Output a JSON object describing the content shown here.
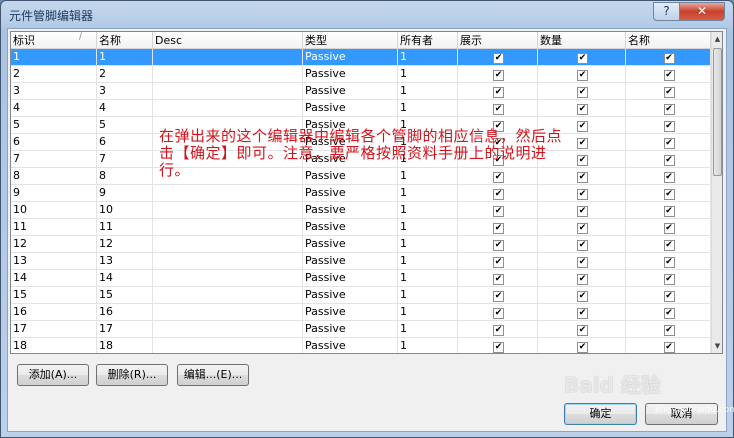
{
  "window": {
    "title": "元件管脚编辑器",
    "help_label": "?",
    "close_label": "✕"
  },
  "columns": [
    "标识",
    "名称",
    "Desc",
    "类型",
    "所有者",
    "展示",
    "数量",
    "名称"
  ],
  "rows": [
    {
      "id": "1",
      "name": "1",
      "desc": "",
      "type": "Passive",
      "owner": "1",
      "show": true,
      "qty": true,
      "named": true
    },
    {
      "id": "2",
      "name": "2",
      "desc": "",
      "type": "Passive",
      "owner": "1",
      "show": true,
      "qty": true,
      "named": true
    },
    {
      "id": "3",
      "name": "3",
      "desc": "",
      "type": "Passive",
      "owner": "1",
      "show": true,
      "qty": true,
      "named": true
    },
    {
      "id": "4",
      "name": "4",
      "desc": "",
      "type": "Passive",
      "owner": "1",
      "show": true,
      "qty": true,
      "named": true
    },
    {
      "id": "5",
      "name": "5",
      "desc": "",
      "type": "Passive",
      "owner": "1",
      "show": true,
      "qty": true,
      "named": true
    },
    {
      "id": "6",
      "name": "6",
      "desc": "",
      "type": "Passive",
      "owner": "1",
      "show": true,
      "qty": true,
      "named": true
    },
    {
      "id": "7",
      "name": "7",
      "desc": "",
      "type": "Passive",
      "owner": "1",
      "show": true,
      "qty": true,
      "named": true
    },
    {
      "id": "8",
      "name": "8",
      "desc": "",
      "type": "Passive",
      "owner": "1",
      "show": true,
      "qty": true,
      "named": true
    },
    {
      "id": "9",
      "name": "9",
      "desc": "",
      "type": "Passive",
      "owner": "1",
      "show": true,
      "qty": true,
      "named": true
    },
    {
      "id": "10",
      "name": "10",
      "desc": "",
      "type": "Passive",
      "owner": "1",
      "show": true,
      "qty": true,
      "named": true
    },
    {
      "id": "11",
      "name": "11",
      "desc": "",
      "type": "Passive",
      "owner": "1",
      "show": true,
      "qty": true,
      "named": true
    },
    {
      "id": "12",
      "name": "12",
      "desc": "",
      "type": "Passive",
      "owner": "1",
      "show": true,
      "qty": true,
      "named": true
    },
    {
      "id": "13",
      "name": "13",
      "desc": "",
      "type": "Passive",
      "owner": "1",
      "show": true,
      "qty": true,
      "named": true
    },
    {
      "id": "14",
      "name": "14",
      "desc": "",
      "type": "Passive",
      "owner": "1",
      "show": true,
      "qty": true,
      "named": true
    },
    {
      "id": "15",
      "name": "15",
      "desc": "",
      "type": "Passive",
      "owner": "1",
      "show": true,
      "qty": true,
      "named": true
    },
    {
      "id": "16",
      "name": "16",
      "desc": "",
      "type": "Passive",
      "owner": "1",
      "show": true,
      "qty": true,
      "named": true
    },
    {
      "id": "17",
      "name": "17",
      "desc": "",
      "type": "Passive",
      "owner": "1",
      "show": true,
      "qty": true,
      "named": true
    },
    {
      "id": "18",
      "name": "18",
      "desc": "",
      "type": "Passive",
      "owner": "1",
      "show": true,
      "qty": true,
      "named": true
    }
  ],
  "selected_row": 0,
  "buttons": {
    "add": "添加(A)...",
    "delete": "删除(R)...",
    "edit": "编辑...(E)...",
    "ok": "确定",
    "cancel": "取消"
  },
  "annotation": "在弹出来的这个编辑器中编辑各个管脚的相应信息，然后点击【确定】即可。注意，要严格按照资料手册上的说明进行。",
  "watermark": {
    "logo": "Baid 经验",
    "url": "jingyan.baidu.com"
  },
  "colors": {
    "selection": "#3399ff",
    "annotation": "#d2141e"
  }
}
